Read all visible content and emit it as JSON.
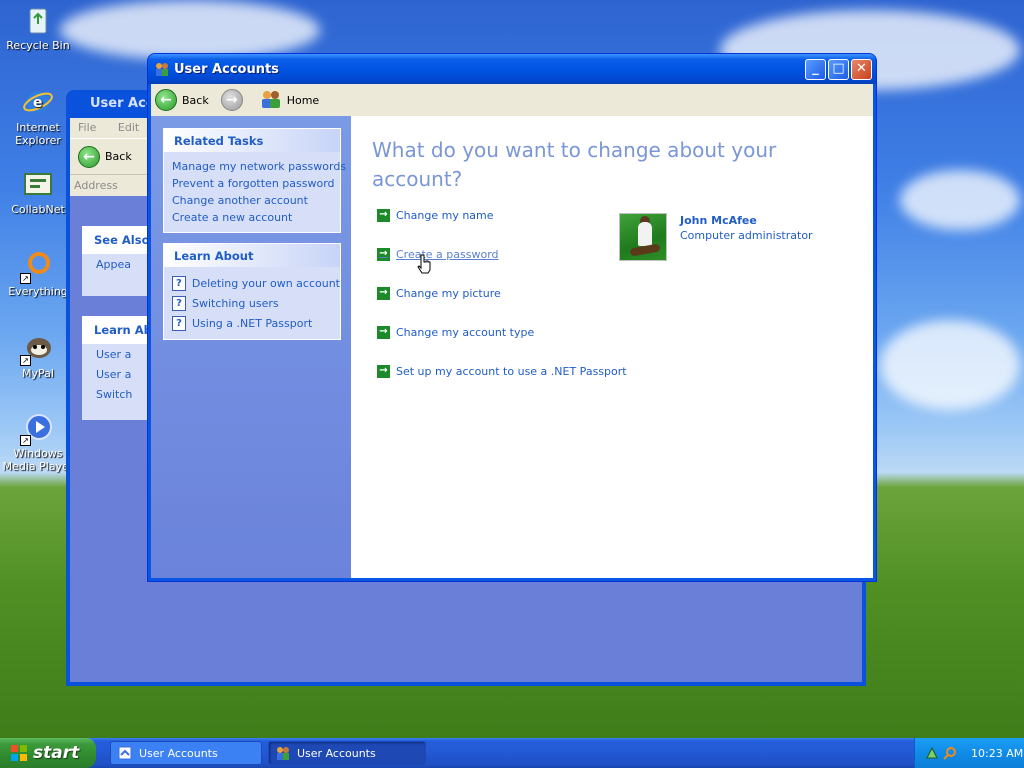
{
  "desktop": {
    "icons": [
      {
        "label": "Recycle Bin",
        "icon": "recycle-bin-icon"
      },
      {
        "label": "Internet Explorer",
        "icon": "internet-explorer-icon"
      },
      {
        "label": "CollabNet",
        "icon": "collabnet-icon"
      },
      {
        "label": "Everything",
        "icon": "everything-icon"
      },
      {
        "label": "MyPal",
        "icon": "mypal-icon"
      },
      {
        "label": "Windows Media Player",
        "icon": "media-player-icon"
      }
    ]
  },
  "background_window": {
    "title": "User Acco",
    "menu": [
      "File",
      "Edit"
    ],
    "back_label": "Back",
    "address_label": "Address",
    "see_also": {
      "heading": "See Also",
      "items": [
        "Appea"
      ]
    },
    "learn_about": {
      "heading": "Learn Ab",
      "items": [
        "User a",
        "User a",
        "Switch"
      ]
    }
  },
  "window": {
    "title": "User Accounts",
    "nav": {
      "back": "Back",
      "home": "Home"
    },
    "related_tasks": {
      "heading": "Related Tasks",
      "items": [
        "Manage my network passwords",
        "Prevent a forgotten password",
        "Change another account",
        "Create a new account"
      ]
    },
    "learn_about": {
      "heading": "Learn About",
      "items": [
        "Deleting your own account",
        "Switching users",
        "Using a .NET Passport"
      ]
    },
    "main": {
      "heading": "What do you want to change about your account?",
      "choices": [
        "Change my name",
        "Create a password",
        "Change my picture",
        "Change my account type",
        "Set up my account to use a .NET Passport"
      ]
    },
    "user": {
      "name": "John McAfee",
      "role": "Computer administrator"
    }
  },
  "taskbar": {
    "start": "start",
    "items": [
      {
        "label": "User Accounts",
        "active": false
      },
      {
        "label": "User Accounts",
        "active": true
      }
    ],
    "clock": "10:23 AM"
  },
  "colors": {
    "accent": "#215dc6",
    "heading": "#7a96d6",
    "titlebar": "#0054e3",
    "task_green": "#1d8a2a"
  }
}
